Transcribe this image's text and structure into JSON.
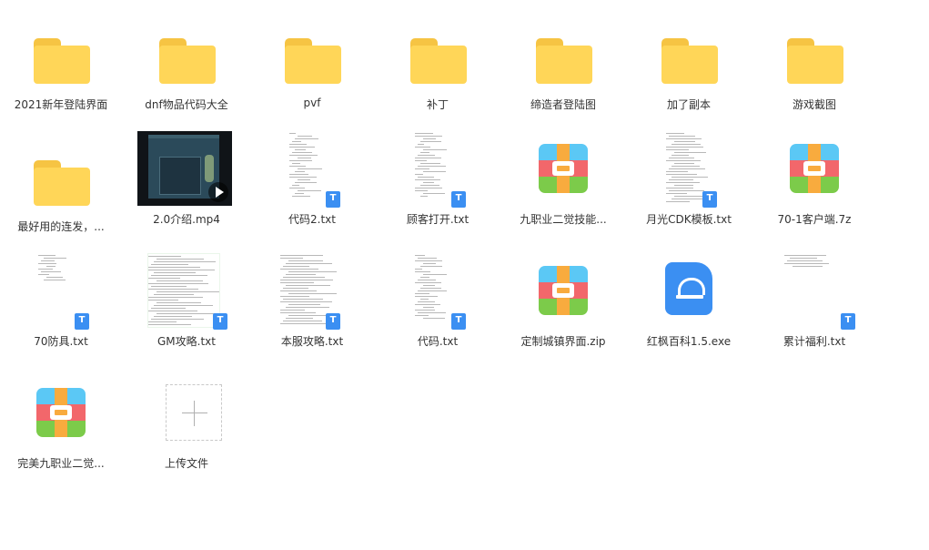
{
  "files": [
    {
      "kind": "folder",
      "label": "2021新年登陆界面",
      "icon": "folder-icon"
    },
    {
      "kind": "folder",
      "label": "dnf物品代码大全",
      "icon": "folder-icon"
    },
    {
      "kind": "folder",
      "label": "pvf",
      "icon": "folder-icon"
    },
    {
      "kind": "folder",
      "label": "补丁",
      "icon": "folder-icon"
    },
    {
      "kind": "folder",
      "label": "缔造者登陆图",
      "icon": "folder-icon"
    },
    {
      "kind": "folder",
      "label": "加了副本",
      "icon": "folder-icon"
    },
    {
      "kind": "folder",
      "label": "游戏截图",
      "icon": "folder-icon"
    },
    {
      "kind": "folder",
      "label": "最好用的连发，...",
      "icon": "folder-icon"
    },
    {
      "kind": "video",
      "label": "2.0介绍.mp4",
      "icon": "video-thumbnail-icon"
    },
    {
      "kind": "text",
      "label": "代码2.txt",
      "icon": "text-file-icon"
    },
    {
      "kind": "text",
      "label": "顾客打开.txt",
      "icon": "text-file-icon"
    },
    {
      "kind": "archive",
      "label": "九职业二觉技能...",
      "icon": "archive-icon"
    },
    {
      "kind": "text",
      "label": "月光CDK模板.txt",
      "icon": "text-file-icon"
    },
    {
      "kind": "archive",
      "label": "70-1客户端.7z",
      "icon": "archive-icon"
    },
    {
      "kind": "text",
      "label": "70防具.txt",
      "icon": "text-file-icon"
    },
    {
      "kind": "text",
      "label": "GM攻略.txt",
      "icon": "text-file-icon"
    },
    {
      "kind": "text",
      "label": "本服攻略.txt",
      "icon": "text-file-icon"
    },
    {
      "kind": "text",
      "label": "代码.txt",
      "icon": "text-file-icon"
    },
    {
      "kind": "archive",
      "label": "定制城镇界面.zip",
      "icon": "archive-icon"
    },
    {
      "kind": "exe",
      "label": "红枫百科1.5.exe",
      "icon": "exe-app-icon"
    },
    {
      "kind": "text",
      "label": "累计福利.txt",
      "icon": "text-file-icon"
    },
    {
      "kind": "archive",
      "label": "完美九职业二觉...",
      "icon": "archive-icon"
    }
  ],
  "upload": {
    "label": "上传文件",
    "icon": "plus-icon"
  },
  "colors": {
    "folder": "#ffd658",
    "folder_tab": "#f6c443",
    "text_badge": "#3b8ff2",
    "exe": "#3b8ff2",
    "label_text": "#333333"
  }
}
